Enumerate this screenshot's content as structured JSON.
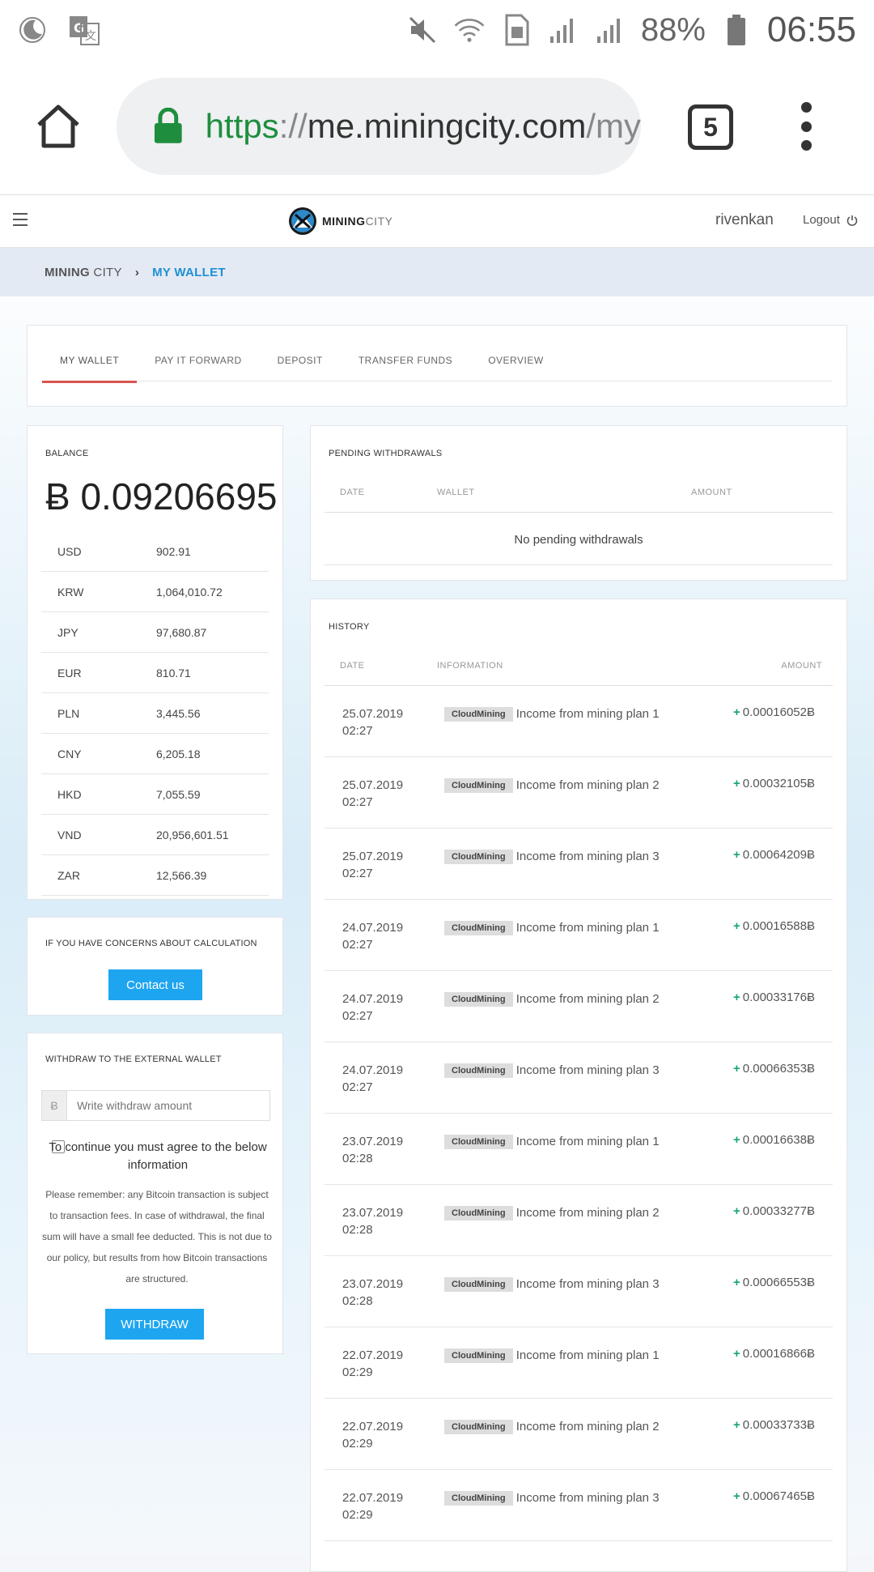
{
  "status_bar": {
    "battery": "88%",
    "time": "06:55"
  },
  "browser": {
    "url_scheme": "https",
    "url_sep": "://",
    "url_host": "me.miningcity.com",
    "url_rest": "/my",
    "tab_count": "5"
  },
  "header": {
    "logo_main": "MINING",
    "logo_accent": "CITY",
    "username": "rivenkan",
    "logout": "Logout"
  },
  "breadcrumb": {
    "root_strong": "MINING",
    "root_rest": " CITY",
    "separator": "›",
    "current": "MY WALLET"
  },
  "tabs": [
    "MY WALLET",
    "PAY IT FORWARD",
    "DEPOSIT",
    "TRANSFER FUNDS",
    "OVERVIEW"
  ],
  "balance": {
    "title": "BALANCE",
    "amount": "Ƀ 0.09206695",
    "currencies": [
      {
        "code": "USD",
        "value": "902.91"
      },
      {
        "code": "KRW",
        "value": "1,064,010.72"
      },
      {
        "code": "JPY",
        "value": "97,680.87"
      },
      {
        "code": "EUR",
        "value": "810.71"
      },
      {
        "code": "PLN",
        "value": "3,445.56"
      },
      {
        "code": "CNY",
        "value": "6,205.18"
      },
      {
        "code": "HKD",
        "value": "7,055.59"
      },
      {
        "code": "VND",
        "value": "20,956,601.51"
      },
      {
        "code": "ZAR",
        "value": "12,566.39"
      }
    ]
  },
  "concern": {
    "title": "IF YOU HAVE CONCERNS ABOUT CALCULATION",
    "button": "Contact us"
  },
  "withdraw": {
    "title": "WITHDRAW TO THE EXTERNAL WALLET",
    "prefix": "Ƀ",
    "placeholder": "Write withdraw amount",
    "agree_text": "To continue you must agree to the below information",
    "remember_text": "Please remember: any Bitcoin transaction is subject to transaction fees. In case of withdrawal, the final sum will have a small fee deducted. This is not due to our policy, but results from how Bitcoin transactions are structured.",
    "button": "WITHDRAW"
  },
  "pending": {
    "title": "PENDING WITHDRAWALS",
    "col_date": "DATE",
    "col_wallet": "WALLET",
    "col_amount": "AMOUNT",
    "empty": "No pending withdrawals"
  },
  "history": {
    "title": "HISTORY",
    "col_date": "DATE",
    "col_info": "INFORMATION",
    "col_amount": "AMOUNT",
    "badge": "CloudMining",
    "info_prefix": "Income from mining plan",
    "plus": "+",
    "rows": [
      {
        "date": "25.07.2019",
        "time": "02:27",
        "plan": "1",
        "amount": "0.00016052Ƀ"
      },
      {
        "date": "25.07.2019",
        "time": "02:27",
        "plan": "2",
        "amount": "0.00032105Ƀ"
      },
      {
        "date": "25.07.2019",
        "time": "02:27",
        "plan": "3",
        "amount": "0.00064209Ƀ"
      },
      {
        "date": "24.07.2019",
        "time": "02:27",
        "plan": "1",
        "amount": "0.00016588Ƀ"
      },
      {
        "date": "24.07.2019",
        "time": "02:27",
        "plan": "2",
        "amount": "0.00033176Ƀ"
      },
      {
        "date": "24.07.2019",
        "time": "02:27",
        "plan": "3",
        "amount": "0.00066353Ƀ"
      },
      {
        "date": "23.07.2019",
        "time": "02:28",
        "plan": "1",
        "amount": "0.00016638Ƀ"
      },
      {
        "date": "23.07.2019",
        "time": "02:28",
        "plan": "2",
        "amount": "0.00033277Ƀ"
      },
      {
        "date": "23.07.2019",
        "time": "02:28",
        "plan": "3",
        "amount": "0.00066553Ƀ"
      },
      {
        "date": "22.07.2019",
        "time": "02:29",
        "plan": "1",
        "amount": "0.00016866Ƀ"
      },
      {
        "date": "22.07.2019",
        "time": "02:29",
        "plan": "2",
        "amount": "0.00033733Ƀ"
      },
      {
        "date": "22.07.2019",
        "time": "02:29",
        "plan": "3",
        "amount": "0.00067465Ƀ"
      }
    ]
  }
}
